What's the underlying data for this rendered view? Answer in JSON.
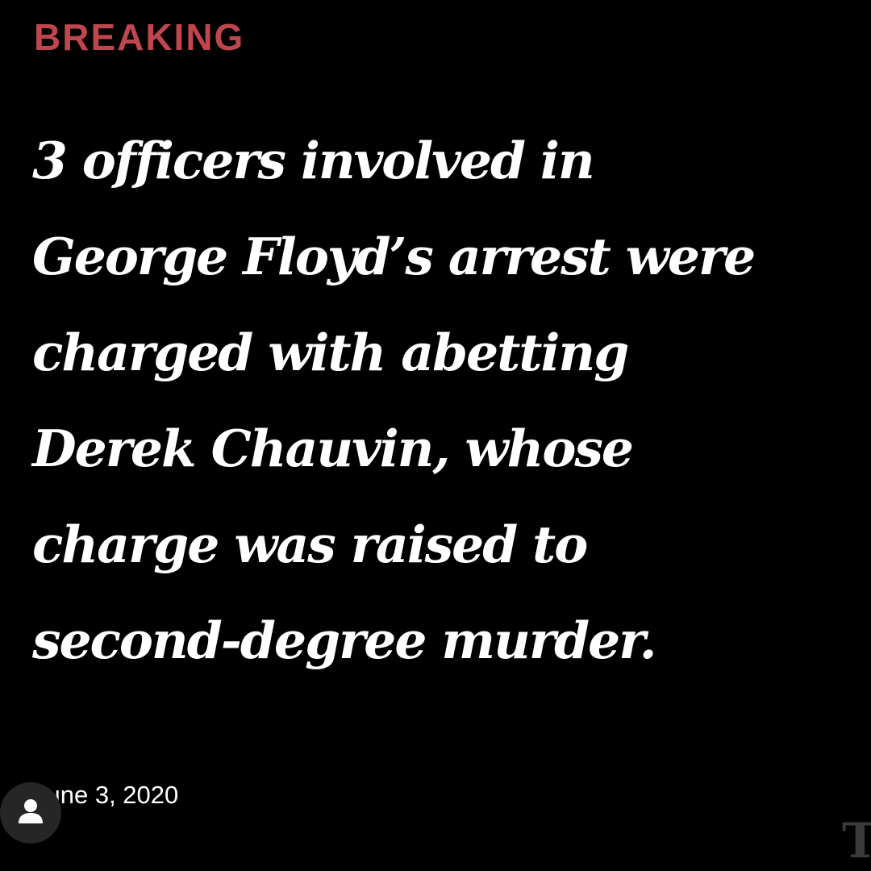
{
  "card": {
    "label": "BREAKING",
    "headline_lines": [
      "3 officers involved in",
      "George Floyd’s arrest were",
      "charged with abetting",
      "Derek Chauvin, whose",
      "charge was raised to",
      "second-degree murder."
    ],
    "date": "June 3, 2020",
    "logo_glyph": "T"
  },
  "overlay": {
    "avatar_icon": "user-icon"
  },
  "colors": {
    "background": "#000000",
    "label": "#c0464d",
    "headline": "#ffffff",
    "avatar_bg": "#262626"
  }
}
